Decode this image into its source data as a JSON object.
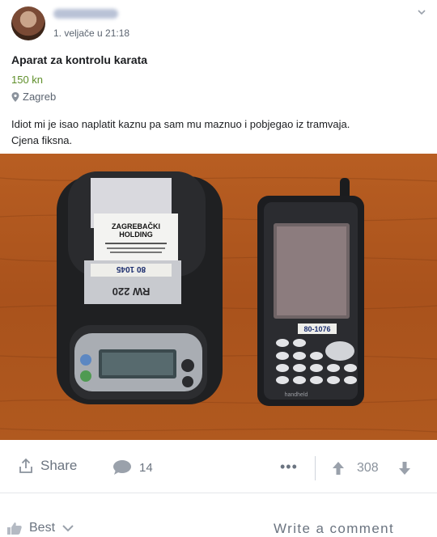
{
  "post": {
    "date": "1. veljače u 21:18"
  },
  "listing": {
    "title": "Aparat za kontrolu karata",
    "price": "150 kn",
    "location": "Zagreb",
    "description_line1": "Idiot mi je isao naplatit kaznu pa sam mu maznuo i pobjegao iz tramvaja.",
    "description_line2": "Cjena fiksna."
  },
  "photo": {
    "receipt_header_line1": "ZAGREBAČKI",
    "receipt_header_line2": "HOLDING",
    "printer_model": "RW 220",
    "tape_label_printer": "80 1045",
    "tape_label_handheld": "80-1076",
    "handheld_brand": "handheld"
  },
  "actions": {
    "share_label": "Share",
    "comment_count": "14",
    "more_label": "•••",
    "vote_count": "308"
  },
  "footer": {
    "sort_label": "Best",
    "write_comment_placeholder": "Write a comment"
  },
  "colors": {
    "price": "#5f8f2a",
    "muted_text": "#6b7480",
    "table_wood": "#b25a20"
  }
}
